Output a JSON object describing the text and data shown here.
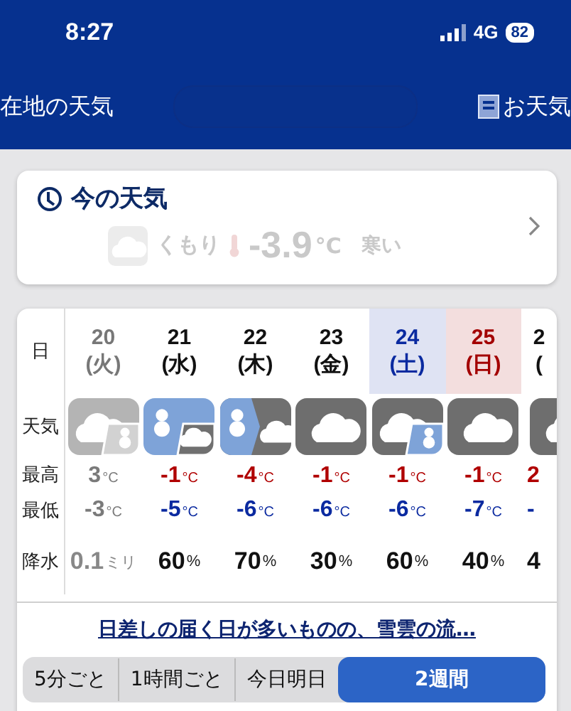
{
  "status_bar": {
    "time": "8:27",
    "network": "4G",
    "battery": "82"
  },
  "nav": {
    "left_link": "在地の天気",
    "right_link": "お天気"
  },
  "current": {
    "title": "今の天気",
    "condition": "くもり",
    "temperature": "-3.9",
    "unit": "°C",
    "feeling": "寒い"
  },
  "forecast": {
    "row_labels": {
      "date": "日",
      "weather": "天気",
      "high": "最高",
      "low": "最低",
      "precip": "降水"
    },
    "days": [
      {
        "date": "20",
        "weekday": "(火)",
        "color": "#777777",
        "highlighted": false,
        "past": true,
        "kind": "cloud-snow",
        "high": "3",
        "high_unit": "°C",
        "low": "-3",
        "low_unit": "°C",
        "precip": "0.1",
        "precip_unit": "ミリ"
      },
      {
        "date": "21",
        "weekday": "(水)",
        "color": "#111111",
        "highlighted": false,
        "past": false,
        "kind": "snow-cloud",
        "high": "-1",
        "high_unit": "°C",
        "low": "-5",
        "low_unit": "°C",
        "precip": "60",
        "precip_unit": "%"
      },
      {
        "date": "22",
        "weekday": "(木)",
        "color": "#111111",
        "highlighted": false,
        "past": false,
        "kind": "snow-split",
        "high": "-4",
        "high_unit": "°C",
        "low": "-6",
        "low_unit": "°C",
        "precip": "70",
        "precip_unit": "%"
      },
      {
        "date": "23",
        "weekday": "(金)",
        "color": "#111111",
        "highlighted": false,
        "past": false,
        "kind": "cloud",
        "high": "-1",
        "high_unit": "°C",
        "low": "-6",
        "low_unit": "°C",
        "precip": "30",
        "precip_unit": "%"
      },
      {
        "date": "24",
        "weekday": "(土)",
        "color": "#0a2aa0",
        "highlighted": true,
        "past": false,
        "kind": "cloud-snow",
        "high": "-1",
        "high_unit": "°C",
        "low": "-6",
        "low_unit": "°C",
        "precip": "60",
        "precip_unit": "%"
      },
      {
        "date": "25",
        "weekday": "(日)",
        "color": "#a30000",
        "highlighted": true,
        "past": false,
        "kind": "cloud",
        "high": "-1",
        "high_unit": "°C",
        "low": "-7",
        "low_unit": "°C",
        "precip": "40",
        "precip_unit": "%"
      },
      {
        "date": "2",
        "weekday": "(",
        "color": "#111111",
        "highlighted": false,
        "past": false,
        "kind": "cloud",
        "high": "2",
        "low": "-",
        "precip": "4"
      }
    ]
  },
  "summary_link": "日差しの届く日が多いものの、雪雲の流…",
  "view_tabs": [
    {
      "label": "5分ごと",
      "selected": false
    },
    {
      "label": "1時間ごと",
      "selected": false
    },
    {
      "label": "今日明日",
      "selected": false
    },
    {
      "label": "2週間",
      "selected": true
    }
  ]
}
